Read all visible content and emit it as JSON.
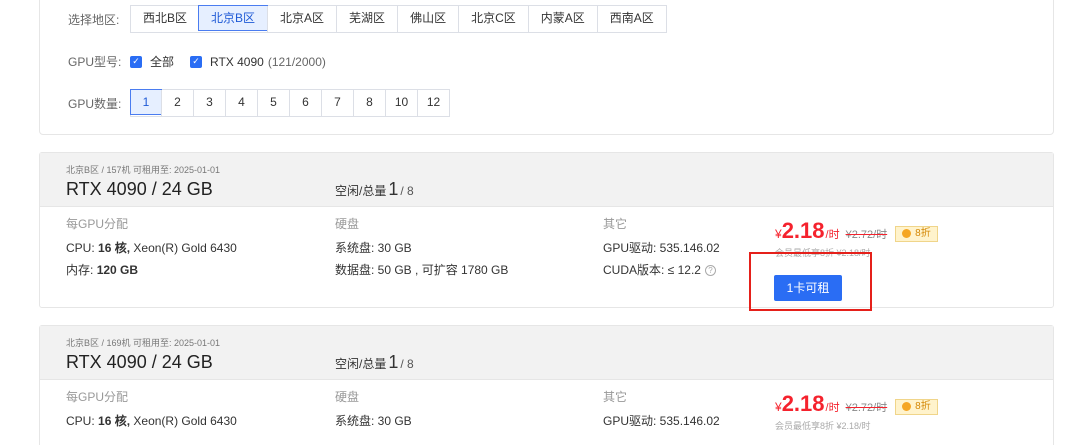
{
  "filters": {
    "region": {
      "label": "选择地区:",
      "options": [
        "西北B区",
        "北京B区",
        "北京A区",
        "芜湖区",
        "佛山区",
        "北京C区",
        "内蒙A区",
        "西南A区"
      ],
      "selected": "北京B区"
    },
    "model": {
      "label": "GPU型号:",
      "all_label": "全部",
      "model_name": "RTX 4090",
      "model_count": "(121/2000)"
    },
    "count": {
      "label": "GPU数量:",
      "options": [
        "1",
        "2",
        "3",
        "4",
        "5",
        "6",
        "7",
        "8",
        "10",
        "12"
      ],
      "selected": "1"
    }
  },
  "cards": [
    {
      "meta": "北京B区 / 157机  可租用至: 2025-01-01",
      "title": "RTX 4090 / 24 GB",
      "free_label": "空闲/总量",
      "free": "1",
      "total": "/ 8",
      "alloc_header": "每GPU分配",
      "cpu_label": "CPU:",
      "cpu_cores": "16 核,",
      "cpu_model": "Xeon(R) Gold 6430",
      "mem_label": "内存:",
      "mem_value": "120 GB",
      "disk_header": "硬盘",
      "sys_disk": "系统盘:  30 GB",
      "data_disk": "数据盘:  50 GB , 可扩容 1780 GB",
      "other_header": "其它",
      "driver": "GPU驱动:  535.146.02",
      "cuda": "CUDA版本:  ≤ 12.2",
      "price_yen": "¥",
      "price": "2.18",
      "price_unit": "/时",
      "price_orig": "¥2.72/时",
      "discount": "8折",
      "member_price": "会员最低享8折 ¥2.18/时",
      "rent_button": "1卡可租"
    },
    {
      "meta": "北京B区 / 169机  可租用至: 2025-01-01",
      "title": "RTX 4090 / 24 GB",
      "free_label": "空闲/总量",
      "free": "1",
      "total": "/ 8",
      "alloc_header": "每GPU分配",
      "cpu_label": "CPU:",
      "cpu_cores": "16 核,",
      "cpu_model": "Xeon(R) Gold 6430",
      "disk_header": "硬盘",
      "sys_disk": "系统盘:  30 GB",
      "other_header": "其它",
      "driver": "GPU驱动:  535.146.02",
      "price_yen": "¥",
      "price": "2.18",
      "price_unit": "/时",
      "price_orig": "¥2.72/时",
      "discount": "8折",
      "member_price": "会员最低享8折 ¥2.18/时"
    }
  ],
  "colors": {
    "accent": "#2a6df4",
    "price": "#f5222d",
    "highlight": "#e5201a"
  }
}
